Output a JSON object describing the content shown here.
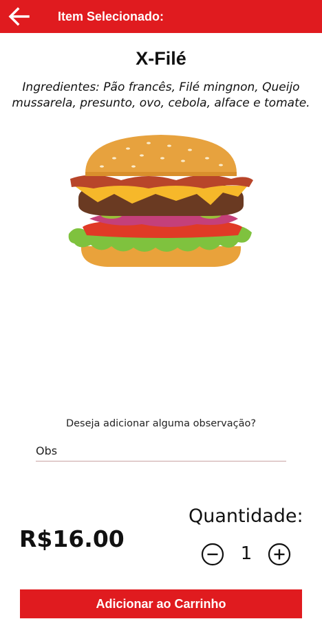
{
  "appbar": {
    "title": "Item Selecionado:",
    "back_icon": "arrow-left-icon",
    "color": "#e01b1f"
  },
  "item": {
    "name": "X-Filé",
    "ingredients": "Ingredientes: Pão francês, Filé mingnon, Queijo mussarela, presunto, ovo, cebola, alface e tomate.",
    "image": "burger-image"
  },
  "observation": {
    "question": "Deseja adicionar alguma observação?",
    "placeholder": "Obs",
    "value": ""
  },
  "price": {
    "text": "R$16.00"
  },
  "quantity": {
    "label": "Quantidade:",
    "value": "1",
    "minus_icon": "minus-circle-icon",
    "plus_icon": "plus-circle-icon"
  },
  "cart_button": {
    "label": "Adicionar ao Carrinho"
  }
}
